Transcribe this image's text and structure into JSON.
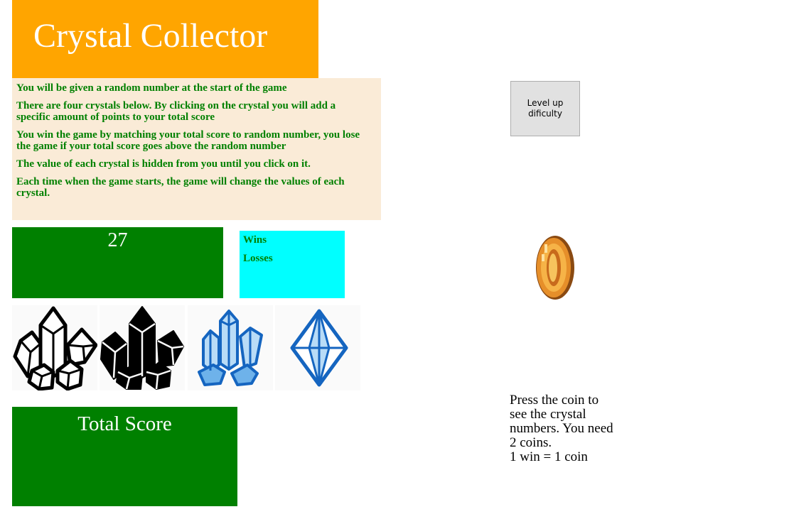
{
  "header": {
    "title": "Crystal Collector"
  },
  "rules": [
    "You will be given a random number at the start of the game",
    "There are four crystals below. By clicking on the crystal you will add a specific amount of points to your total score",
    "You win the game by matching your total score to random number, you lose the game if your total score goes above the random number",
    "The value of each crystal is hidden from you until you click on it.",
    "Each time when the game starts, the game will change the values of each crystal."
  ],
  "random_number": "27",
  "scoreboard": {
    "wins_label": "Wins",
    "losses_label": "Losses"
  },
  "crystals": [
    {
      "icon": "crystal-outline-icon"
    },
    {
      "icon": "crystal-solid-icon"
    },
    {
      "icon": "crystal-cluster-blue-icon"
    },
    {
      "icon": "diamond-blue-icon"
    }
  ],
  "total_score": {
    "label": "Total Score"
  },
  "level_button": {
    "label": "Level up dificulty"
  },
  "coin": {
    "icon": "coin-icon"
  },
  "coin_text": {
    "line1": "Press the coin to see the crystal numbers. You need 2 coins.",
    "line2": "1 win = 1 coin"
  },
  "colors": {
    "title_bg": "#ffa500",
    "rules_bg": "#faebd7",
    "text_green": "#008000",
    "score_panel_bg": "#00ffff",
    "crystal_blue": "#1565c0"
  }
}
